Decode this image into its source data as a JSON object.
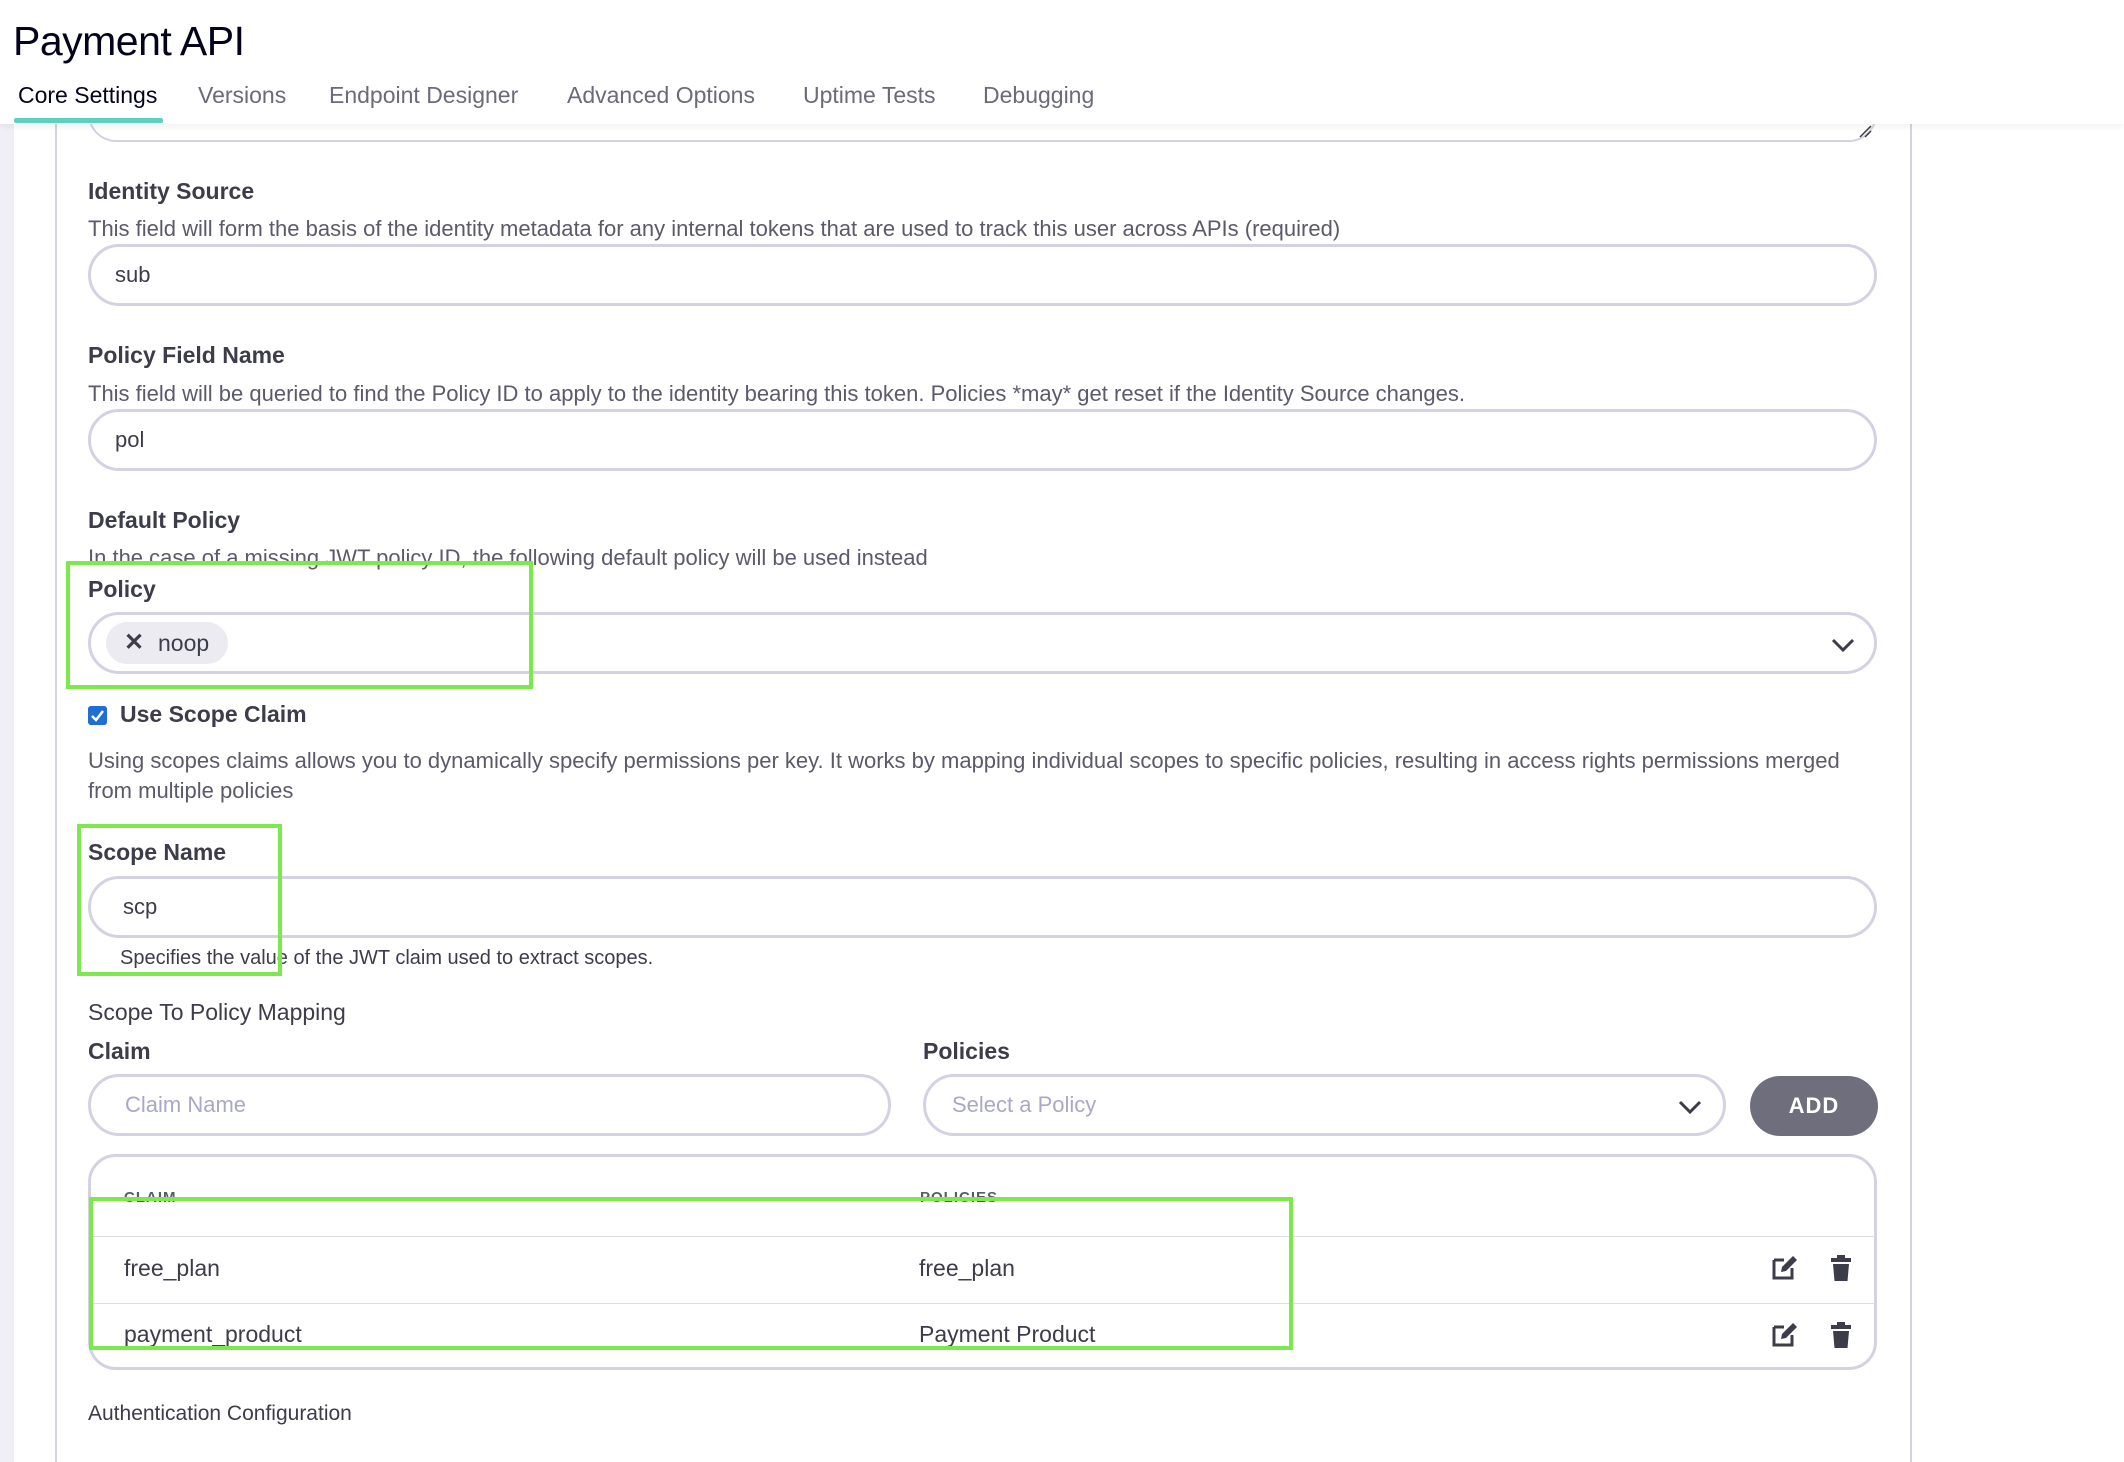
{
  "header": {
    "title": "Payment API",
    "tabs": [
      {
        "label": "Core Settings",
        "active": true
      },
      {
        "label": "Versions",
        "active": false
      },
      {
        "label": "Endpoint Designer",
        "active": false
      },
      {
        "label": "Advanced Options",
        "active": false
      },
      {
        "label": "Uptime Tests",
        "active": false
      },
      {
        "label": "Debugging",
        "active": false
      }
    ]
  },
  "identity_source": {
    "label": "Identity Source",
    "help": "This field will form the basis of the identity metadata for any internal tokens that are used to track this user across APIs (required)",
    "value": "sub"
  },
  "policy_field_name": {
    "label": "Policy Field Name",
    "help": "This field will be queried to find the Policy ID to apply to the identity bearing this token. Policies *may* get reset if the Identity Source changes.",
    "value": "pol"
  },
  "default_policy": {
    "label": "Default Policy",
    "help": "In the case of a missing JWT policy ID, the following default policy will be used instead",
    "policy_label": "Policy",
    "selected": "noop"
  },
  "use_scope_claim": {
    "label": "Use Scope Claim",
    "checked": true,
    "help": "Using scopes claims allows you to dynamically specify permissions per key. It works by mapping individual scopes to specific policies, resulting in access rights permissions merged from multiple policies"
  },
  "scope_name": {
    "label": "Scope Name",
    "value": "scp",
    "help": "Specifies the value of the JWT claim used to extract scopes."
  },
  "scope_mapping": {
    "title": "Scope To Policy Mapping",
    "claim_label": "Claim",
    "claim_placeholder": "Claim Name",
    "policies_label": "Policies",
    "policies_placeholder": "Select a Policy",
    "add_label": "ADD",
    "table": {
      "headers": [
        "CLAIM",
        "POLICIES"
      ],
      "rows": [
        {
          "claim": "free_plan",
          "policy": "free_plan"
        },
        {
          "claim": "payment_product",
          "policy": "Payment Product"
        }
      ]
    }
  },
  "authentication_configuration": {
    "title": "Authentication Configuration"
  },
  "colors": {
    "accent_underline": "#5fd0bf",
    "highlight": "#7ce84e",
    "checkbox": "#1f6ed4",
    "add_button": "#6f6e7c"
  },
  "icons": [
    "close-icon",
    "chevron-down-icon",
    "edit-icon",
    "trash-icon",
    "checkbox-checked-icon",
    "resize-grip-icon"
  ]
}
